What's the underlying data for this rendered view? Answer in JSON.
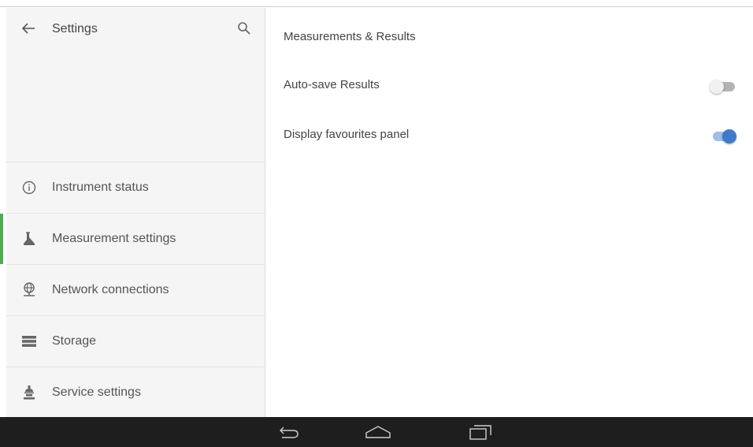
{
  "sidebar": {
    "title": "Settings",
    "back_icon": "arrow-left-icon",
    "search_icon": "search-icon",
    "items": [
      {
        "label": "Instrument status",
        "icon": "info-icon",
        "active": false
      },
      {
        "label": "Measurement settings",
        "icon": "flask-icon",
        "active": true
      },
      {
        "label": "Network connections",
        "icon": "globe-network-icon",
        "active": false
      },
      {
        "label": "Storage",
        "icon": "storage-icon",
        "active": false
      },
      {
        "label": "Service settings",
        "icon": "service-icon",
        "active": false
      }
    ]
  },
  "content": {
    "section_title": "Measurements & Results",
    "settings": [
      {
        "label": "Auto-save Results",
        "enabled": false
      },
      {
        "label": "Display favourites panel",
        "enabled": true
      }
    ]
  },
  "colors": {
    "active_indicator": "#4caf50",
    "toggle_on": "#3f79c9",
    "toggle_on_track": "#9fbde6",
    "navbar_bg": "#1e1e1e"
  },
  "navbar": {
    "icons": [
      "back-icon",
      "home-icon",
      "recents-icon"
    ]
  }
}
